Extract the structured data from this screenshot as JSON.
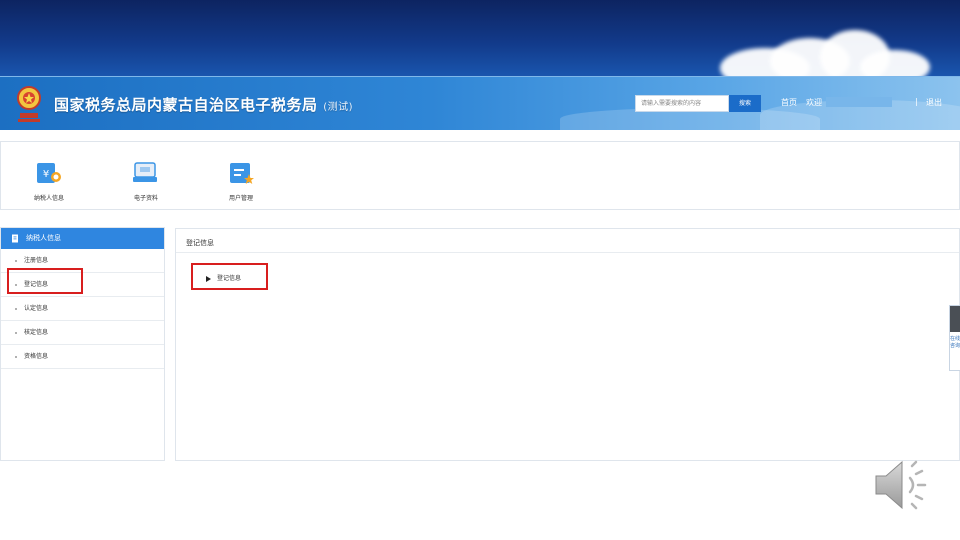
{
  "header": {
    "site_title": "国家税务总局内蒙古自治区电子税务局",
    "site_title_suffix": "(测试)",
    "search_placeholder": "请输入需要搜索的内容",
    "search_button": "搜索",
    "home_link": "首页",
    "welcome_text": "欢迎",
    "logout_link": "退出",
    "separator": "|"
  },
  "quick_nav": {
    "items": [
      {
        "label": "纳税人信息",
        "icon": "taxpayer-info-icon"
      },
      {
        "label": "电子资料",
        "icon": "electronic-docs-icon"
      },
      {
        "label": "用户管理",
        "icon": "user-management-icon"
      }
    ]
  },
  "sidebar": {
    "header": "纳税人信息",
    "items": [
      {
        "label": "注册信息"
      },
      {
        "label": "登记信息",
        "highlighted": true
      },
      {
        "label": "认定信息"
      },
      {
        "label": "核定信息"
      },
      {
        "label": "资格信息"
      }
    ]
  },
  "main": {
    "title": "登记信息",
    "tree_item": "登记信息"
  },
  "float_tab": {
    "text": "在线咨询"
  },
  "colors": {
    "header_blue": "#2f86d6",
    "sidebar_header": "#2f86e0",
    "highlight_red": "#d81e1e"
  }
}
